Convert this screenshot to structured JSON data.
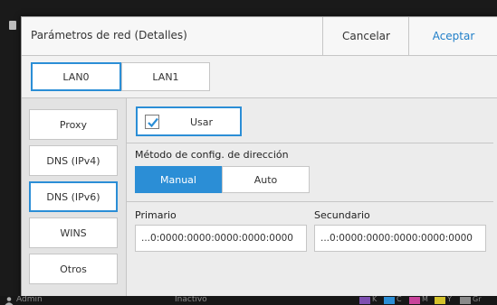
{
  "dialog": {
    "title": "Parámetros de red (Detalles)",
    "cancel_label": "Cancelar",
    "accept_label": "Aceptar"
  },
  "tabs": [
    {
      "label": "LAN0",
      "selected": true
    },
    {
      "label": "LAN1",
      "selected": false
    }
  ],
  "sidebar": {
    "items": [
      {
        "label": "Proxy",
        "selected": false
      },
      {
        "label": "DNS (IPv4)",
        "selected": false
      },
      {
        "label": "DNS (IPv6)",
        "selected": true
      },
      {
        "label": "WINS",
        "selected": false
      },
      {
        "label": "Otros",
        "selected": false
      }
    ]
  },
  "panel": {
    "use_label": "Usar",
    "use_checked": true,
    "method_label": "Método de config. de dirección",
    "method_options": [
      {
        "label": "Manual",
        "selected": true
      },
      {
        "label": "Auto",
        "selected": false
      }
    ],
    "primary_label": "Primario",
    "primary_value": "...0:0000:0000:0000:0000:0000",
    "secondary_label": "Secundario",
    "secondary_value": "...0:0000:0000:0000:0000:0000"
  },
  "status": {
    "user": "Admin",
    "state": "Inactivo",
    "inks": [
      {
        "letter": "K",
        "color": "#7d4fb0"
      },
      {
        "letter": "C",
        "color": "#2b8ed6"
      },
      {
        "letter": "M",
        "color": "#c8439a"
      },
      {
        "letter": "Y",
        "color": "#d4c22b"
      },
      {
        "letter": "Gr",
        "color": "#8a8a8a"
      }
    ]
  },
  "colors": {
    "accent": "#2b8ed6",
    "accept_text": "#1f7ec8"
  }
}
